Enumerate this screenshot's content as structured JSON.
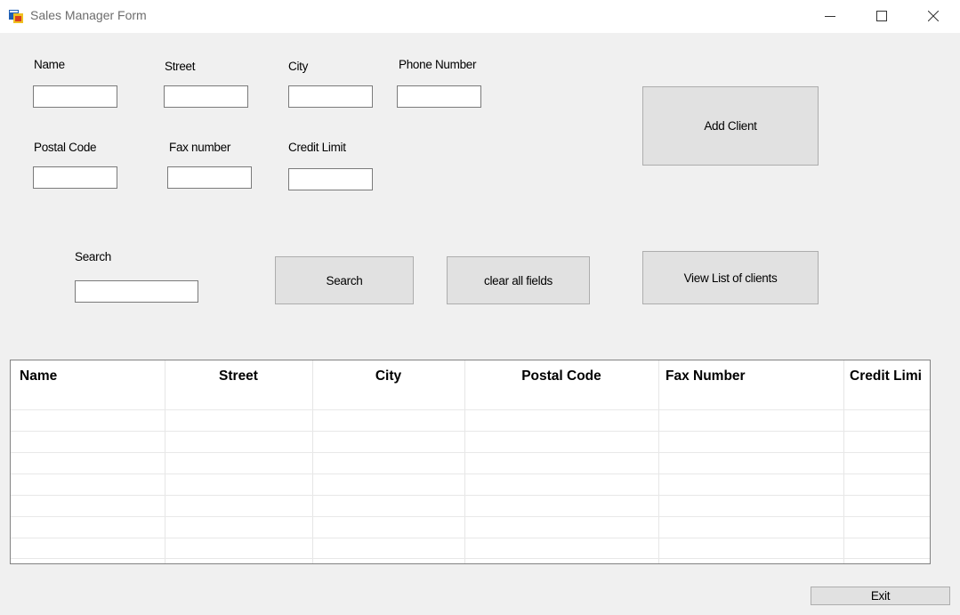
{
  "window": {
    "title": "Sales Manager Form",
    "icon": "form-app-icon"
  },
  "form": {
    "name_label": "Name",
    "street_label": "Street",
    "city_label": "City",
    "phone_label": "Phone Number",
    "postal_label": "Postal Code",
    "fax_label": "Fax number",
    "credit_label": "Credit Limit",
    "search_label": "Search",
    "name_value": "",
    "street_value": "",
    "city_value": "",
    "phone_value": "",
    "postal_value": "",
    "fax_value": "",
    "credit_value": "",
    "search_value": ""
  },
  "buttons": {
    "add_client": "Add Client",
    "search": "Search",
    "clear_all": "clear all fields",
    "view_list": "View List of clients",
    "exit": "Exit"
  },
  "grid": {
    "columns": [
      "Name",
      "Street",
      "City",
      "Postal Code",
      "Fax Number",
      "Credit Limi"
    ],
    "rows": []
  }
}
